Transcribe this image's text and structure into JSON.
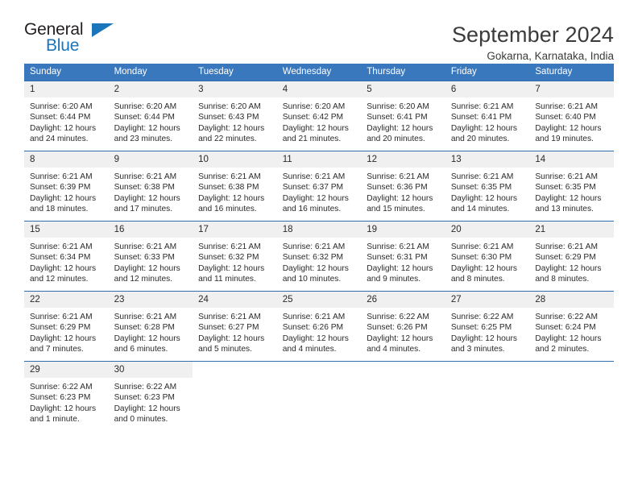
{
  "logo": {
    "word_one": "General",
    "word_two": "Blue",
    "triangle_icon": "triangle-icon"
  },
  "header": {
    "title": "September 2024",
    "subtitle": "Gokarna, Karnataka, India"
  },
  "colors": {
    "header_blue": "#3a78bd",
    "rule_blue": "#2f6fb0",
    "daynum_band": "#f0f0f0",
    "logo_blue": "#1b75bb",
    "text": "#2a2a2a"
  },
  "weekday_headers": [
    "Sunday",
    "Monday",
    "Tuesday",
    "Wednesday",
    "Thursday",
    "Friday",
    "Saturday"
  ],
  "weeks": [
    [
      {
        "day": "1",
        "sunrise": "Sunrise: 6:20 AM",
        "sunset": "Sunset: 6:44 PM",
        "daylight": "Daylight: 12 hours and 24 minutes."
      },
      {
        "day": "2",
        "sunrise": "Sunrise: 6:20 AM",
        "sunset": "Sunset: 6:44 PM",
        "daylight": "Daylight: 12 hours and 23 minutes."
      },
      {
        "day": "3",
        "sunrise": "Sunrise: 6:20 AM",
        "sunset": "Sunset: 6:43 PM",
        "daylight": "Daylight: 12 hours and 22 minutes."
      },
      {
        "day": "4",
        "sunrise": "Sunrise: 6:20 AM",
        "sunset": "Sunset: 6:42 PM",
        "daylight": "Daylight: 12 hours and 21 minutes."
      },
      {
        "day": "5",
        "sunrise": "Sunrise: 6:20 AM",
        "sunset": "Sunset: 6:41 PM",
        "daylight": "Daylight: 12 hours and 20 minutes."
      },
      {
        "day": "6",
        "sunrise": "Sunrise: 6:21 AM",
        "sunset": "Sunset: 6:41 PM",
        "daylight": "Daylight: 12 hours and 20 minutes."
      },
      {
        "day": "7",
        "sunrise": "Sunrise: 6:21 AM",
        "sunset": "Sunset: 6:40 PM",
        "daylight": "Daylight: 12 hours and 19 minutes."
      }
    ],
    [
      {
        "day": "8",
        "sunrise": "Sunrise: 6:21 AM",
        "sunset": "Sunset: 6:39 PM",
        "daylight": "Daylight: 12 hours and 18 minutes."
      },
      {
        "day": "9",
        "sunrise": "Sunrise: 6:21 AM",
        "sunset": "Sunset: 6:38 PM",
        "daylight": "Daylight: 12 hours and 17 minutes."
      },
      {
        "day": "10",
        "sunrise": "Sunrise: 6:21 AM",
        "sunset": "Sunset: 6:38 PM",
        "daylight": "Daylight: 12 hours and 16 minutes."
      },
      {
        "day": "11",
        "sunrise": "Sunrise: 6:21 AM",
        "sunset": "Sunset: 6:37 PM",
        "daylight": "Daylight: 12 hours and 16 minutes."
      },
      {
        "day": "12",
        "sunrise": "Sunrise: 6:21 AM",
        "sunset": "Sunset: 6:36 PM",
        "daylight": "Daylight: 12 hours and 15 minutes."
      },
      {
        "day": "13",
        "sunrise": "Sunrise: 6:21 AM",
        "sunset": "Sunset: 6:35 PM",
        "daylight": "Daylight: 12 hours and 14 minutes."
      },
      {
        "day": "14",
        "sunrise": "Sunrise: 6:21 AM",
        "sunset": "Sunset: 6:35 PM",
        "daylight": "Daylight: 12 hours and 13 minutes."
      }
    ],
    [
      {
        "day": "15",
        "sunrise": "Sunrise: 6:21 AM",
        "sunset": "Sunset: 6:34 PM",
        "daylight": "Daylight: 12 hours and 12 minutes."
      },
      {
        "day": "16",
        "sunrise": "Sunrise: 6:21 AM",
        "sunset": "Sunset: 6:33 PM",
        "daylight": "Daylight: 12 hours and 12 minutes."
      },
      {
        "day": "17",
        "sunrise": "Sunrise: 6:21 AM",
        "sunset": "Sunset: 6:32 PM",
        "daylight": "Daylight: 12 hours and 11 minutes."
      },
      {
        "day": "18",
        "sunrise": "Sunrise: 6:21 AM",
        "sunset": "Sunset: 6:32 PM",
        "daylight": "Daylight: 12 hours and 10 minutes."
      },
      {
        "day": "19",
        "sunrise": "Sunrise: 6:21 AM",
        "sunset": "Sunset: 6:31 PM",
        "daylight": "Daylight: 12 hours and 9 minutes."
      },
      {
        "day": "20",
        "sunrise": "Sunrise: 6:21 AM",
        "sunset": "Sunset: 6:30 PM",
        "daylight": "Daylight: 12 hours and 8 minutes."
      },
      {
        "day": "21",
        "sunrise": "Sunrise: 6:21 AM",
        "sunset": "Sunset: 6:29 PM",
        "daylight": "Daylight: 12 hours and 8 minutes."
      }
    ],
    [
      {
        "day": "22",
        "sunrise": "Sunrise: 6:21 AM",
        "sunset": "Sunset: 6:29 PM",
        "daylight": "Daylight: 12 hours and 7 minutes."
      },
      {
        "day": "23",
        "sunrise": "Sunrise: 6:21 AM",
        "sunset": "Sunset: 6:28 PM",
        "daylight": "Daylight: 12 hours and 6 minutes."
      },
      {
        "day": "24",
        "sunrise": "Sunrise: 6:21 AM",
        "sunset": "Sunset: 6:27 PM",
        "daylight": "Daylight: 12 hours and 5 minutes."
      },
      {
        "day": "25",
        "sunrise": "Sunrise: 6:21 AM",
        "sunset": "Sunset: 6:26 PM",
        "daylight": "Daylight: 12 hours and 4 minutes."
      },
      {
        "day": "26",
        "sunrise": "Sunrise: 6:22 AM",
        "sunset": "Sunset: 6:26 PM",
        "daylight": "Daylight: 12 hours and 4 minutes."
      },
      {
        "day": "27",
        "sunrise": "Sunrise: 6:22 AM",
        "sunset": "Sunset: 6:25 PM",
        "daylight": "Daylight: 12 hours and 3 minutes."
      },
      {
        "day": "28",
        "sunrise": "Sunrise: 6:22 AM",
        "sunset": "Sunset: 6:24 PM",
        "daylight": "Daylight: 12 hours and 2 minutes."
      }
    ],
    [
      {
        "day": "29",
        "sunrise": "Sunrise: 6:22 AM",
        "sunset": "Sunset: 6:23 PM",
        "daylight": "Daylight: 12 hours and 1 minute."
      },
      {
        "day": "30",
        "sunrise": "Sunrise: 6:22 AM",
        "sunset": "Sunset: 6:23 PM",
        "daylight": "Daylight: 12 hours and 0 minutes."
      },
      {
        "day": "",
        "sunrise": "",
        "sunset": "",
        "daylight": ""
      },
      {
        "day": "",
        "sunrise": "",
        "sunset": "",
        "daylight": ""
      },
      {
        "day": "",
        "sunrise": "",
        "sunset": "",
        "daylight": ""
      },
      {
        "day": "",
        "sunrise": "",
        "sunset": "",
        "daylight": ""
      },
      {
        "day": "",
        "sunrise": "",
        "sunset": "",
        "daylight": ""
      }
    ]
  ]
}
